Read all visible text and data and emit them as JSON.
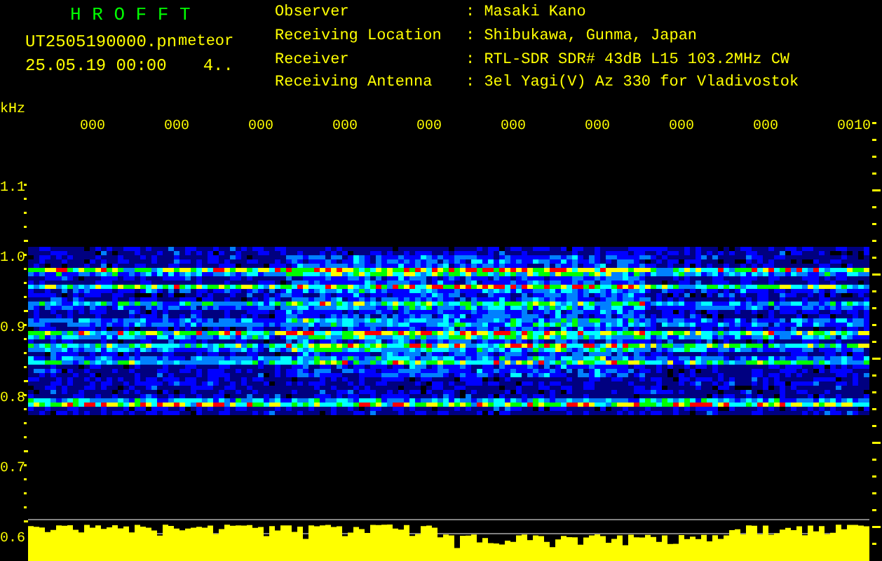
{
  "header": {
    "title": "H R O F F T",
    "filename": "UT2505190000.pn",
    "mode": "meteor",
    "datetime": "25.05.19 00:00",
    "counter": "4..",
    "info": [
      {
        "label": "Observer",
        "value": ": Masaki Kano"
      },
      {
        "label": "Receiving Location",
        "value": ": Shibukawa, Gunma, Japan"
      },
      {
        "label": "Receiver",
        "value": ": RTL-SDR SDR# 43dB L15 103.2MHz CW"
      },
      {
        "label": "Receiving Antenna",
        "value": ": 3el Yagi(V) Az 330 for Vladivostok"
      }
    ]
  },
  "plot": {
    "unit": "kHz",
    "time_labels": [
      "000",
      "000",
      "000",
      "000",
      "000",
      "000",
      "000",
      "000",
      "000",
      "0010"
    ],
    "frequency_labels": [
      "1.1",
      "1.0",
      "0.9",
      "0.8",
      "0.7",
      "0.6"
    ]
  }
}
